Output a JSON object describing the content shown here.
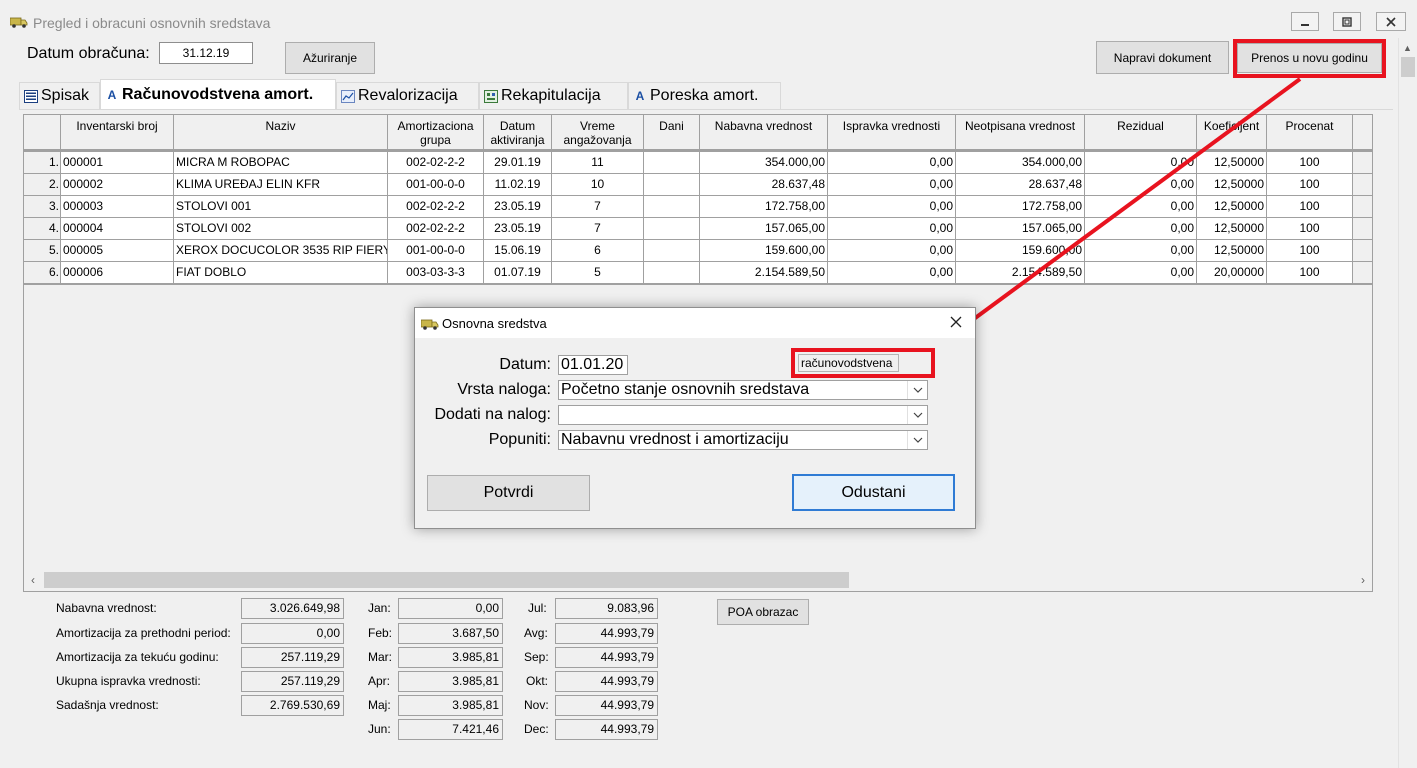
{
  "window": {
    "title": "Pregled i obracuni osnovnih sredstava"
  },
  "top": {
    "datum_label": "Datum obračuna:",
    "datum_value": "31.12.19",
    "azuriranje_label": "Ažuriranje",
    "napravi_label": "Napravi dokument",
    "prenos_label": "Prenos u novu godinu"
  },
  "tabs": [
    {
      "label": "Spisak"
    },
    {
      "label": "Računovodstvena amort."
    },
    {
      "label": "Revalorizacija"
    },
    {
      "label": "Rekapitulacija"
    },
    {
      "label": "Poreska amort."
    }
  ],
  "table": {
    "columns": [
      "Inventarski broj",
      "Naziv",
      "Amortizaciona grupa",
      "Datum aktiviranja",
      "Vreme angažovanja",
      "Dani",
      "Nabavna vrednost",
      "Ispravka vrednosti",
      "Neotpisana vrednost",
      "Rezidual",
      "Koeficijent",
      "Procenat"
    ],
    "rows": [
      {
        "no": "1.",
        "inv": "000001",
        "naziv": "MICRA M ROBOPAC",
        "grupa": "002-02-2-2",
        "datum": "29.01.19",
        "vreme": "11",
        "dani": "",
        "nabavna": "354.000,00",
        "ispravka": "0,00",
        "neotpisana": "354.000,00",
        "rezidual": "0,00",
        "koef": "12,50000",
        "procenat": "100"
      },
      {
        "no": "2.",
        "inv": "000002",
        "naziv": "KLIMA UREĐAJ ELIN KFR",
        "grupa": "001-00-0-0",
        "datum": "11.02.19",
        "vreme": "10",
        "dani": "",
        "nabavna": "28.637,48",
        "ispravka": "0,00",
        "neotpisana": "28.637,48",
        "rezidual": "0,00",
        "koef": "12,50000",
        "procenat": "100"
      },
      {
        "no": "3.",
        "inv": "000003",
        "naziv": "STOLOVI 001",
        "grupa": "002-02-2-2",
        "datum": "23.05.19",
        "vreme": "7",
        "dani": "",
        "nabavna": "172.758,00",
        "ispravka": "0,00",
        "neotpisana": "172.758,00",
        "rezidual": "0,00",
        "koef": "12,50000",
        "procenat": "100"
      },
      {
        "no": "4.",
        "inv": "000004",
        "naziv": "STOLOVI 002",
        "grupa": "002-02-2-2",
        "datum": "23.05.19",
        "vreme": "7",
        "dani": "",
        "nabavna": "157.065,00",
        "ispravka": "0,00",
        "neotpisana": "157.065,00",
        "rezidual": "0,00",
        "koef": "12,50000",
        "procenat": "100"
      },
      {
        "no": "5.",
        "inv": "000005",
        "naziv": "XEROX DOCUCOLOR 3535 RIP FIERY",
        "grupa": "001-00-0-0",
        "datum": "15.06.19",
        "vreme": "6",
        "dani": "",
        "nabavna": "159.600,00",
        "ispravka": "0,00",
        "neotpisana": "159.600,00",
        "rezidual": "0,00",
        "koef": "12,50000",
        "procenat": "100"
      },
      {
        "no": "6.",
        "inv": "000006",
        "naziv": "FIAT DOBLO",
        "grupa": "003-03-3-3",
        "datum": "01.07.19",
        "vreme": "5",
        "dani": "",
        "nabavna": "2.154.589,50",
        "ispravka": "0,00",
        "neotpisana": "2.154.589,50",
        "rezidual": "0,00",
        "koef": "20,00000",
        "procenat": "100"
      }
    ]
  },
  "summary": {
    "left": [
      {
        "label": "Nabavna vrednost:",
        "value": "3.026.649,98"
      },
      {
        "label": "Amortizacija za prethodni period:",
        "value": "0,00"
      },
      {
        "label": "Amortizacija za tekuću godinu:",
        "value": "257.119,29"
      },
      {
        "label": "Ukupna ispravka vrednosti:",
        "value": "257.119,29"
      },
      {
        "label": "Sadašnja vrednost:",
        "value": "2.769.530,69"
      }
    ],
    "months1": [
      {
        "label": "Jan:",
        "value": "0,00"
      },
      {
        "label": "Feb:",
        "value": "3.687,50"
      },
      {
        "label": "Mar:",
        "value": "3.985,81"
      },
      {
        "label": "Apr:",
        "value": "3.985,81"
      },
      {
        "label": "Maj:",
        "value": "3.985,81"
      },
      {
        "label": "Jun:",
        "value": "7.421,46"
      }
    ],
    "months2": [
      {
        "label": "Jul:",
        "value": "9.083,96"
      },
      {
        "label": "Avg:",
        "value": "44.993,79"
      },
      {
        "label": "Sep:",
        "value": "44.993,79"
      },
      {
        "label": "Okt:",
        "value": "44.993,79"
      },
      {
        "label": "Nov:",
        "value": "44.993,79"
      },
      {
        "label": "Dec:",
        "value": "44.993,79"
      }
    ],
    "poa_label": "POA obrazac"
  },
  "dialog": {
    "title": "Osnovna sredstva",
    "datum_label": "Datum:",
    "datum_value": "01.01.20",
    "type_value": "računovodstvena",
    "vrsta_label": "Vrsta naloga:",
    "vrsta_value": "Početno stanje osnovnih sredstava",
    "dodati_label": "Dodati na nalog:",
    "dodati_value": "",
    "popuniti_label": "Popuniti:",
    "popuniti_value": "Nabavnu vrednost i amortizaciju",
    "potvrdi_label": "Potvrdi",
    "odustani_label": "Odustani"
  },
  "colors": {
    "highlight": "#e8131f",
    "window_bg": "#f0f0f0"
  }
}
